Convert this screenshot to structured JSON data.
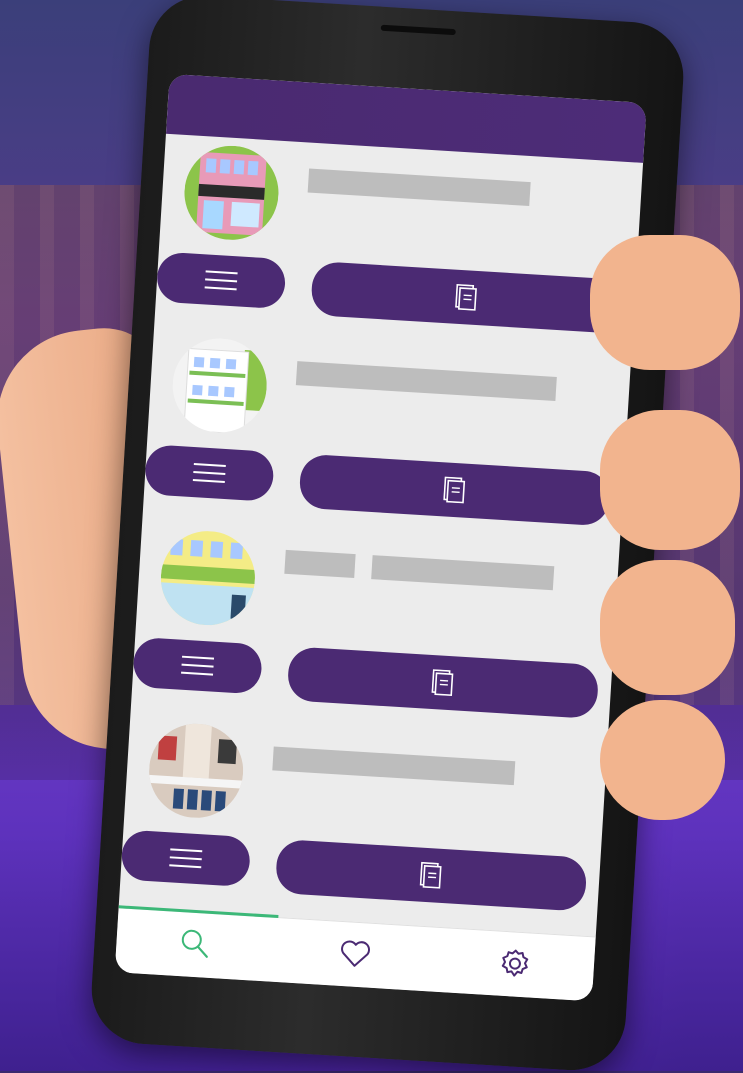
{
  "colors": {
    "primary": "#4b2a73",
    "screen_bg": "#ececec",
    "placeholder_bar": "#bdbdbd",
    "active_indicator": "#3cb878",
    "nav_icon": "#3cb878"
  },
  "list": {
    "items": [
      {
        "image": "cafe-storefront-image",
        "placeholder_bars": 1
      },
      {
        "image": "white-apartment-building-image",
        "placeholder_bars": 1
      },
      {
        "image": "yellow-shopfront-image",
        "placeholder_bars": 2
      },
      {
        "image": "cinema-building-image",
        "placeholder_bars": 1
      }
    ],
    "menu_button_icon": "hamburger-menu-icon",
    "details_button_icon": "document-icon"
  },
  "bottom_nav": {
    "items": [
      {
        "icon": "search-icon",
        "active": true
      },
      {
        "icon": "heart-icon",
        "active": false
      },
      {
        "icon": "settings-gear-icon",
        "active": false
      }
    ]
  }
}
